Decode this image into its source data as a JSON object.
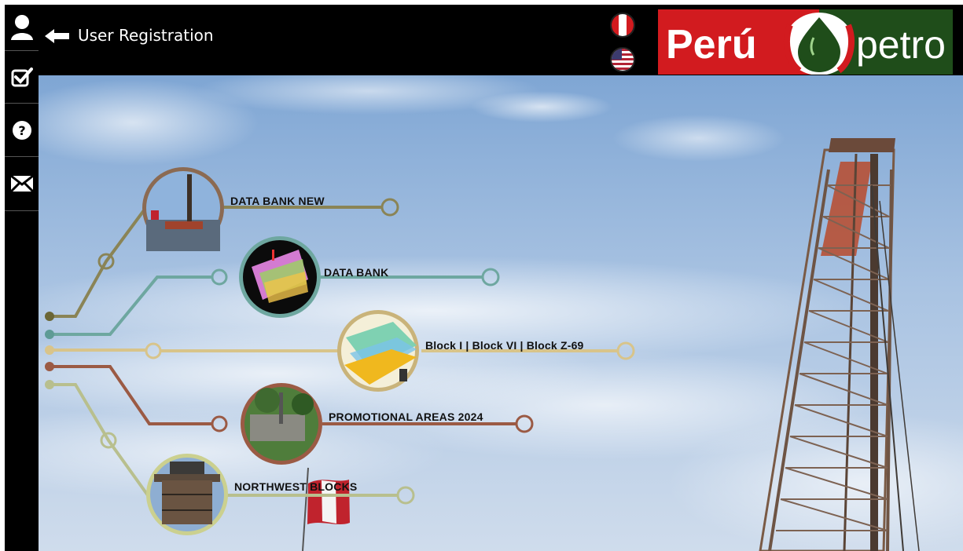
{
  "header": {
    "title": "User Registration",
    "logo_text_left": "Perú",
    "logo_text_right": "petro"
  },
  "sidebar": {
    "items": [
      {
        "name": "user-icon"
      },
      {
        "name": "checklist-icon"
      },
      {
        "name": "help-icon"
      },
      {
        "name": "mail-icon"
      }
    ]
  },
  "languages": [
    "es",
    "en"
  ],
  "menu": [
    {
      "label": "DATA BANK NEW",
      "color": "#8a8456"
    },
    {
      "label": "DATA BANK",
      "color": "#6ea7a0"
    },
    {
      "label": "Block I | Block VI | Block Z-69",
      "color": "#d8c48a"
    },
    {
      "label": "PROMOTIONAL AREAS 2024",
      "color": "#9b5a44"
    },
    {
      "label": "NORTHWEST BLOCKS",
      "color": "#b8bf8e"
    }
  ],
  "colors": {
    "logo_red": "#d21b1f",
    "logo_green": "#1f4d1a",
    "topbar": "#000000"
  }
}
